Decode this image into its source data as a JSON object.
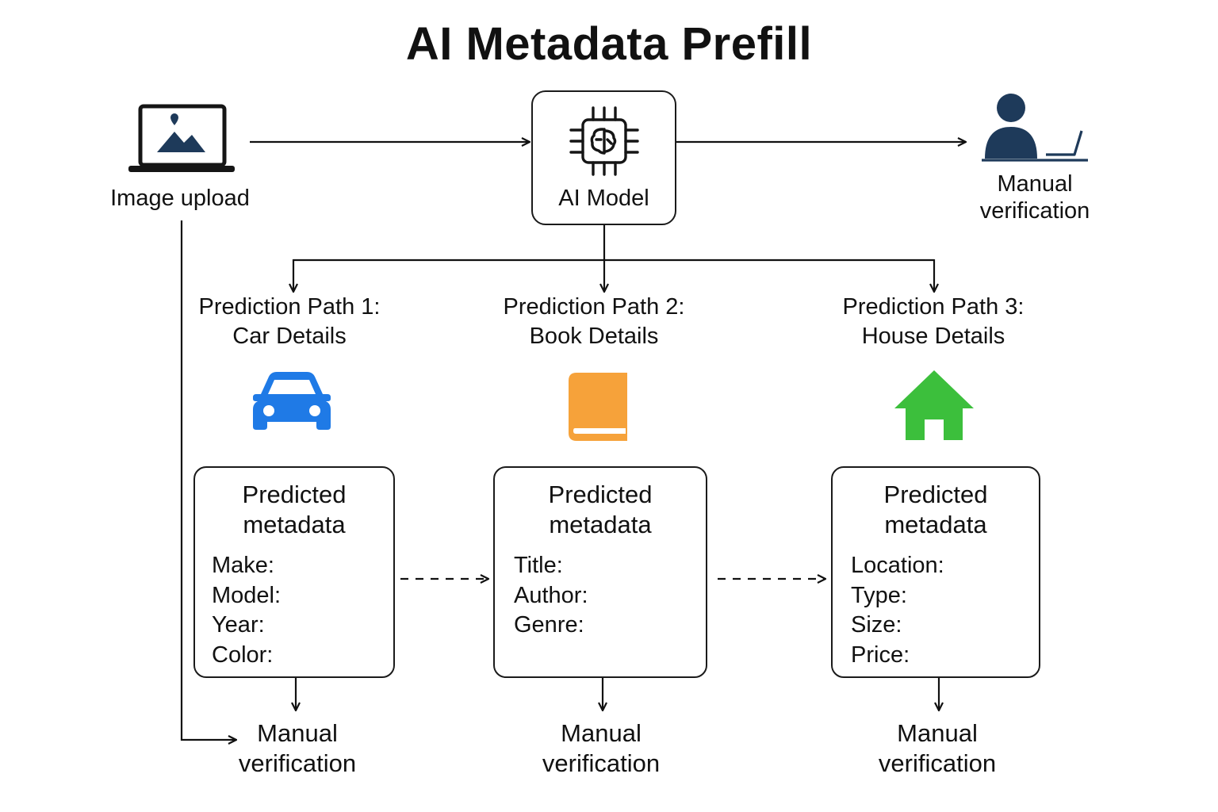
{
  "title": "AI Metadata Prefill",
  "nodes": {
    "image_upload": {
      "label": "Image upload",
      "icon": "laptop-image-icon"
    },
    "ai_model": {
      "label": "AI Model",
      "icon": "ai-chip-icon"
    },
    "top_verification": {
      "label_line1": "Manual",
      "label_line2": "verification",
      "icon": "person-laptop-icon"
    }
  },
  "paths": [
    {
      "heading_line1": "Prediction Path 1:",
      "heading_line2": "Car Details",
      "icon": "car-icon",
      "icon_color": "#1f7ae6",
      "card": {
        "title_line1": "Predicted",
        "title_line2": "metadata",
        "fields": [
          "Make:",
          "Model:",
          "Year:",
          "Color:"
        ]
      },
      "verification_line1": "Manual",
      "verification_line2": "verification"
    },
    {
      "heading_line1": "Prediction Path 2:",
      "heading_line2": "Book Details",
      "icon": "book-icon",
      "icon_color": "#f6a23a",
      "card": {
        "title_line1": "Predicted",
        "title_line2": "metadata",
        "fields": [
          "Title:",
          "Author:",
          "Genre:"
        ]
      },
      "verification_line1": "Manual",
      "verification_line2": "verification"
    },
    {
      "heading_line1": "Prediction Path 3:",
      "heading_line2": "House Details",
      "icon": "house-icon",
      "icon_color": "#3cbf3c",
      "card": {
        "title_line1": "Predicted",
        "title_line2": "metadata",
        "fields": [
          "Location:",
          "Type:",
          "Size:",
          "Price:"
        ]
      },
      "verification_line1": "Manual",
      "verification_line2": "verification"
    }
  ],
  "colors": {
    "stroke": "#111111",
    "icon_navy": "#1e3a5a"
  }
}
